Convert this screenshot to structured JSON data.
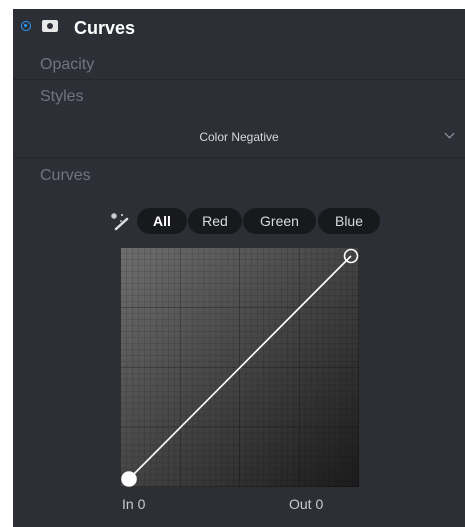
{
  "layer": {
    "title": "Curves",
    "selected": true
  },
  "properties": {
    "opacity_label": "Opacity",
    "styles_label": "Styles",
    "style_value": "Color Negative",
    "curves_label": "Curves"
  },
  "channels": [
    {
      "label": "All",
      "active": true
    },
    {
      "label": "Red",
      "active": false
    },
    {
      "label": "Green",
      "active": false
    },
    {
      "label": "Blue",
      "active": false
    }
  ],
  "curve": {
    "in_label": "In 0",
    "out_label": "Out 0",
    "points": [
      {
        "in": 0,
        "out": 0,
        "selected": true
      },
      {
        "in": 255,
        "out": 255,
        "selected": false
      }
    ]
  },
  "icons": {
    "radio": "radio-selected-icon",
    "mask": "mask-icon",
    "wand": "auto-magic-wand-icon",
    "chevron": "chevron-down-icon"
  },
  "colors": {
    "panel": "#2c2f35",
    "accent": "#2e9bff",
    "chip": "#17191c"
  }
}
